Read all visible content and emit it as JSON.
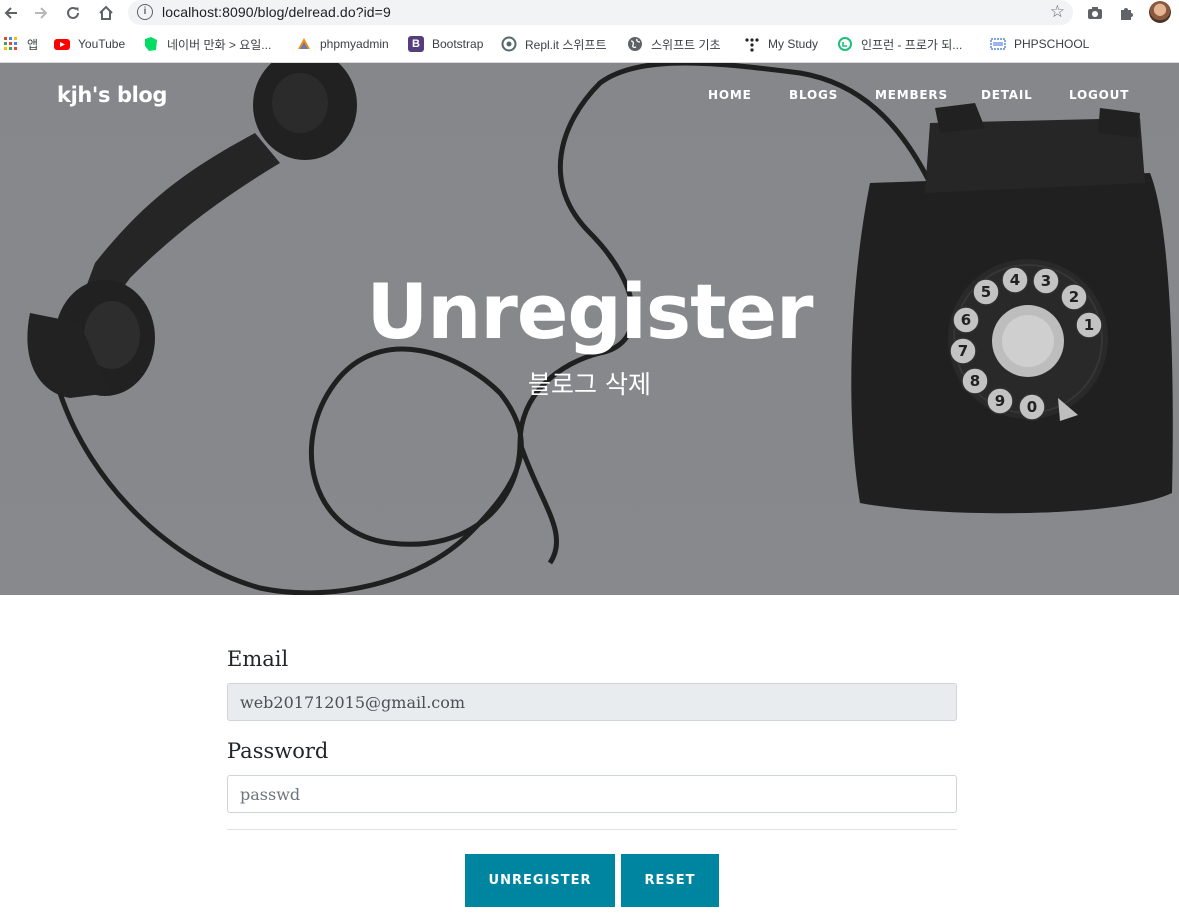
{
  "browser": {
    "url": "localhost:8090/blog/delread.do?id=9",
    "info_glyph": "i",
    "bookmarks": [
      {
        "label": "앱",
        "icon": "apps-grid-icon"
      },
      {
        "label": "YouTube",
        "icon": "youtube-icon"
      },
      {
        "label": "네이버 만화 > 요일...",
        "icon": "naver-webtoon-icon"
      },
      {
        "label": "phpmyadmin",
        "icon": "phpmyadmin-icon"
      },
      {
        "label": "Bootstrap",
        "icon": "bootstrap-icon"
      },
      {
        "label": "Repl.it 스위프트",
        "icon": "replit-icon"
      },
      {
        "label": "스위프트 기초",
        "icon": "globe-icon"
      },
      {
        "label": "My Study",
        "icon": "dots-icon"
      },
      {
        "label": "인프런 - 프로가 되...",
        "icon": "inflearn-icon"
      },
      {
        "label": "PHPSCHOOL",
        "icon": "phpschool-icon"
      }
    ],
    "bootstrap_glyph": "B"
  },
  "site": {
    "brand": "kjh's blog",
    "nav": [
      "HOME",
      "BLOGS",
      "MEMBERS",
      "DETAIL",
      "LOGOUT"
    ]
  },
  "hero": {
    "title": "Unregister",
    "subtitle": "블로그 삭제"
  },
  "form": {
    "email_label": "Email",
    "email_value": "web201712015@gmail.com",
    "password_label": "Password",
    "password_placeholder": "passwd",
    "unregister_label": "UNREGISTER",
    "reset_label": "RESET"
  },
  "colors": {
    "accent": "#0085a1",
    "hero_overlay": "#8a8b8e"
  }
}
